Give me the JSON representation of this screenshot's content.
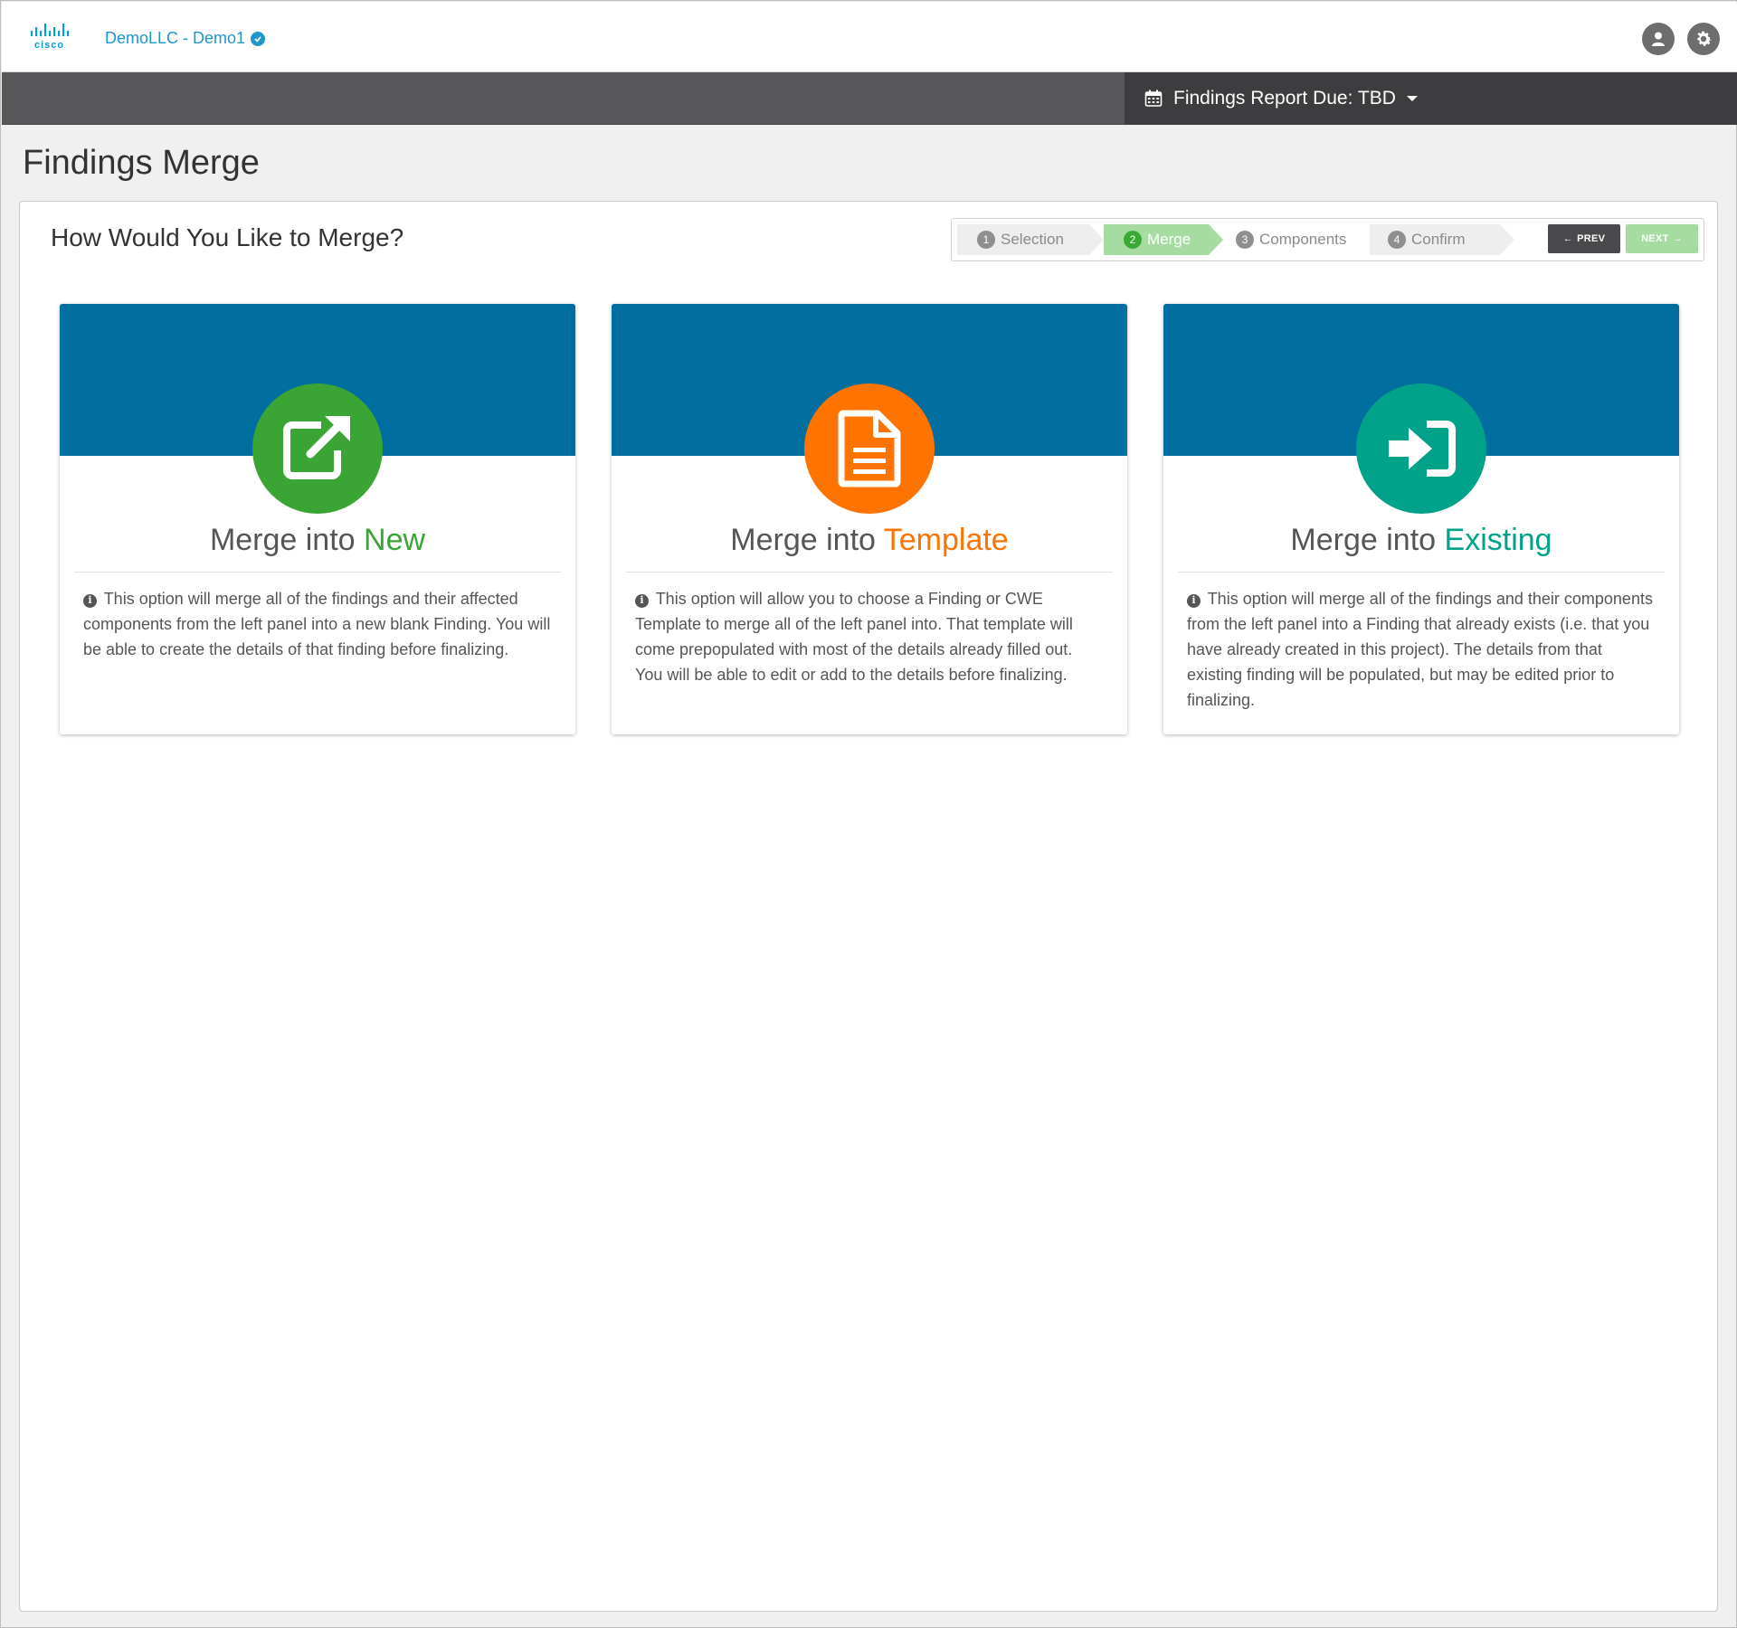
{
  "header": {
    "logo_text": "cisco",
    "org_link": "DemoLLC - Demo1",
    "report_due": "Findings Report Due: TBD",
    "icons": {
      "user": "user-icon",
      "settings": "gear-icon",
      "calendar": "calendar-icon",
      "verified": "check-circle-icon"
    }
  },
  "page": {
    "title": "Findings Merge",
    "panel_heading": "How Would You Like to Merge?"
  },
  "wizard": {
    "steps": [
      {
        "num": "1",
        "label": "Selection",
        "active": false
      },
      {
        "num": "2",
        "label": "Merge",
        "active": true
      },
      {
        "num": "3",
        "label": "Components",
        "active": false
      },
      {
        "num": "4",
        "label": "Confirm",
        "active": false
      }
    ],
    "prev_label": "PREV",
    "next_label": "NEXT"
  },
  "cards": [
    {
      "title_prefix": "Merge into ",
      "title_accent": "New",
      "accent_color": "#3aa535",
      "icon": "external-link-icon",
      "description": "This option will merge all of the findings and their affected components from the left panel into a new blank Finding. You will be able to create the details of that finding before finalizing."
    },
    {
      "title_prefix": "Merge into ",
      "title_accent": "Template",
      "accent_color": "#ff7300",
      "icon": "document-icon",
      "description": "This option will allow you to choose a Finding or CWE Template to merge all of the left panel into. That template will come prepopulated with most of the details already filled out. You will be able to edit or add to the details before finalizing."
    },
    {
      "title_prefix": "Merge into ",
      "title_accent": "Existing",
      "accent_color": "#00a38a",
      "icon": "sign-in-icon",
      "description": "This option will merge all of the findings and their components from the left panel into a Finding that already exists (i.e. that you have already created in this project). The details from that existing finding will be populated, but may be edited prior to finalizing."
    }
  ],
  "colors": {
    "band": "#006e9e",
    "wizard_active": "#a6dca2",
    "link": "#1e98c9"
  }
}
